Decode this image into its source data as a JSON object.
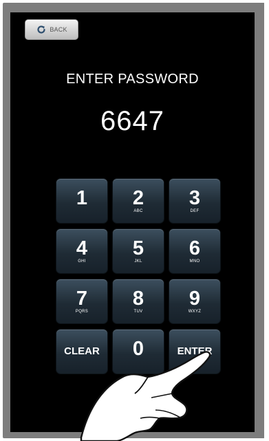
{
  "back_button": {
    "label": "BACK",
    "icon": "refresh-icon"
  },
  "title": "ENTER PASSWORD",
  "entry_value": "6647",
  "keys": [
    {
      "digit": "1",
      "letters": ""
    },
    {
      "digit": "2",
      "letters": "ABC"
    },
    {
      "digit": "3",
      "letters": "DEF"
    },
    {
      "digit": "4",
      "letters": "GHI"
    },
    {
      "digit": "5",
      "letters": "JKL"
    },
    {
      "digit": "6",
      "letters": "MNO"
    },
    {
      "digit": "7",
      "letters": "PQRS"
    },
    {
      "digit": "8",
      "letters": "TUV"
    },
    {
      "digit": "9",
      "letters": "WXYZ"
    },
    {
      "digit": "CLEAR",
      "letters": ""
    },
    {
      "digit": "0",
      "letters": ""
    },
    {
      "digit": "ENTER",
      "letters": ""
    }
  ],
  "pointer": {
    "icon": "pointing-hand-icon"
  },
  "colors": {
    "screen": "#000000",
    "key": "#2a3945",
    "frame": "#7d7d7d"
  }
}
